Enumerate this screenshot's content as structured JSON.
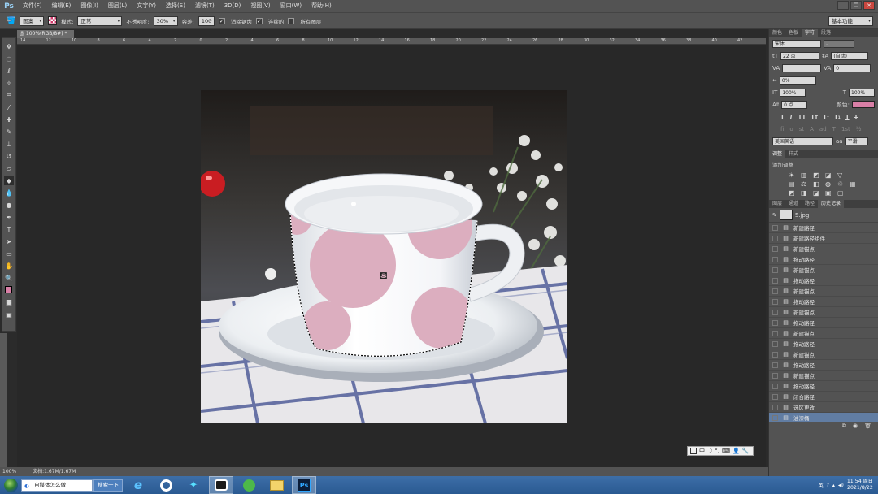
{
  "app": {
    "logo": "Ps"
  },
  "menu": [
    "文件(F)",
    "编辑(E)",
    "图像(I)",
    "图层(L)",
    "文字(Y)",
    "选择(S)",
    "滤镜(T)",
    "3D(D)",
    "视图(V)",
    "窗口(W)",
    "帮助(H)"
  ],
  "window_controls": {
    "minimize": "—",
    "restore": "❐",
    "close": "✕"
  },
  "options": {
    "mode_label": "图案",
    "style_label": "模式:",
    "style_value": "正常",
    "opacity_label": "不透明度:",
    "opacity_value": "30%",
    "tolerance_label": "容差:",
    "tolerance_value": "100",
    "antialias": "消除锯齿",
    "contiguous": "连续的",
    "all_layers": "所有图层",
    "workspace": "基本功能"
  },
  "document": {
    "tab_title": "@ 100%(RGB/8#) *",
    "ruler_ticks": [
      "14",
      "12",
      "10",
      "8",
      "6",
      "4",
      "2",
      "0",
      "2",
      "4",
      "6",
      "8",
      "10",
      "12",
      "14",
      "16",
      "18",
      "20",
      "22",
      "24",
      "26",
      "28",
      "30",
      "32",
      "34",
      "36",
      "38",
      "40",
      "42"
    ],
    "zoom": "100%",
    "doc_info": "文档:1.67M/1.67M"
  },
  "floating_ime": [
    "中",
    "☽",
    "°,",
    "⌨",
    "👤",
    "🔧"
  ],
  "char_panel": {
    "tabs": [
      "颜色",
      "色板",
      "字符",
      "段落"
    ],
    "font_family": "宋体",
    "font_style": "-",
    "size": "22 点",
    "leading": "(自动)",
    "kerning": "",
    "tracking": "0",
    "scale_pct": "0%",
    "vscale": "100%",
    "hscale": "100%",
    "baseline": "0 点",
    "color_label": "颜色:",
    "lang": "美国英语",
    "aa_label": "aa",
    "aa": "平滑",
    "color": "#d97fa6"
  },
  "adjust_panel": {
    "tabs": [
      "调整",
      "样式"
    ],
    "title": "添加调整"
  },
  "history_panel": {
    "tabs": [
      "图层",
      "通道",
      "路径",
      "历史记录"
    ],
    "snapshot": "5.jpg",
    "items": [
      "新建路径",
      "新建路径组件",
      "新建锚点",
      "拖动路径",
      "新建锚点",
      "拖动路径",
      "新建锚点",
      "拖动路径",
      "新建锚点",
      "拖动路径",
      "新建锚点",
      "拖动路径",
      "新建锚点",
      "拖动路径",
      "新建锚点",
      "拖动路径",
      "闭合路径",
      "选区更改",
      "油漆桶"
    ],
    "selected_index": 18
  },
  "taskbar": {
    "search_value": "自媒体怎么做",
    "search_button": "搜索一下",
    "apps": [
      "ie",
      "360",
      "blue-app",
      "video",
      "green-app",
      "folder",
      "photoshop"
    ],
    "clock_time": "11:54 周日",
    "clock_date": "2021/8/22"
  }
}
